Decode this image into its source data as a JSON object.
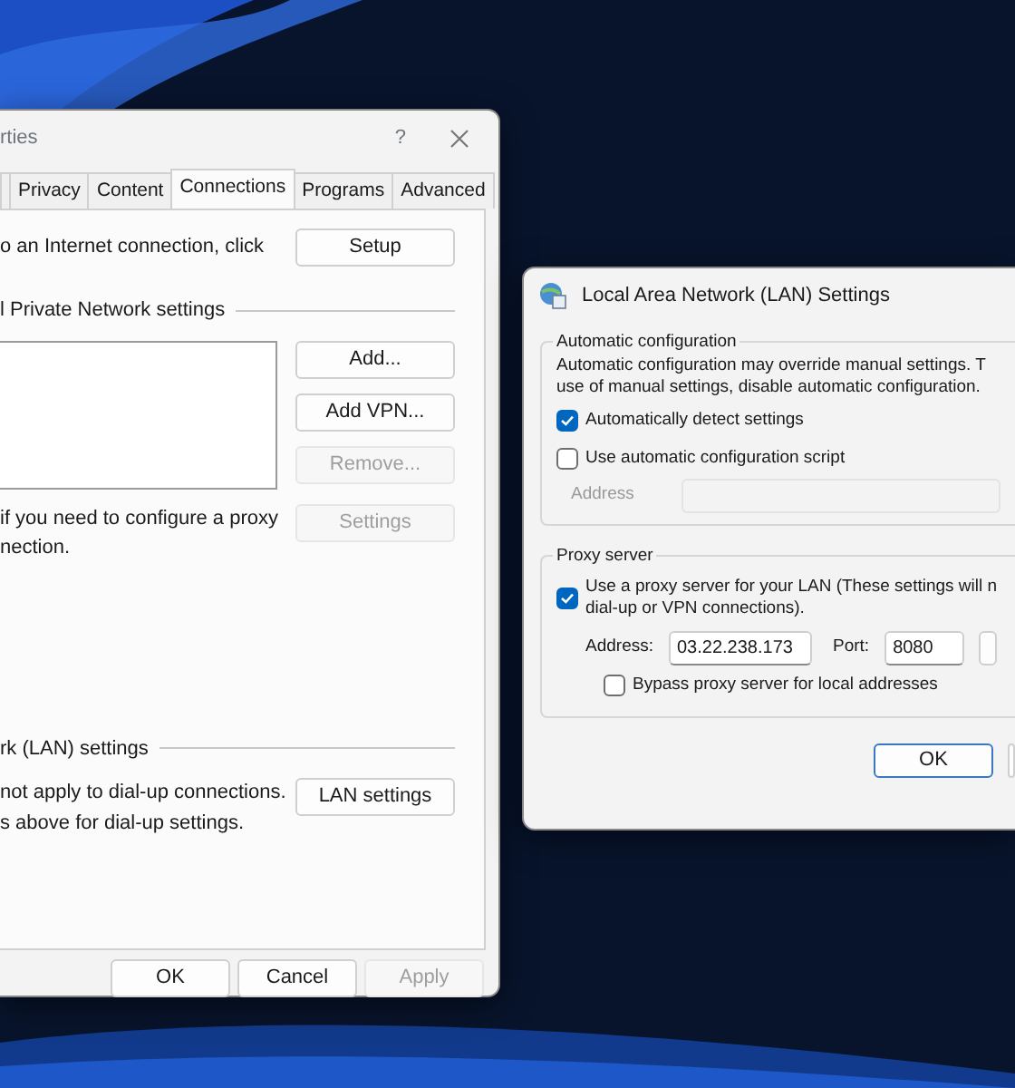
{
  "left_dialog": {
    "title": "rties",
    "help": "?",
    "tabs": [
      {
        "label": "Privacy",
        "selected": false
      },
      {
        "label": "Content",
        "selected": false
      },
      {
        "label": "Connections",
        "selected": true
      },
      {
        "label": "Programs",
        "selected": false
      },
      {
        "label": "Advanced",
        "selected": false
      }
    ],
    "setup_text": "o an Internet connection, click",
    "setup_button": {
      "label": "Setup",
      "disabled": false
    },
    "vpn_group": "l Private Network settings",
    "vpn_buttons": [
      {
        "label": "Add...",
        "disabled": false
      },
      {
        "label": "Add VPN...",
        "disabled": false
      },
      {
        "label": "Remove...",
        "disabled": true
      }
    ],
    "proxy_text": [
      "if you need to configure a proxy",
      "nection."
    ],
    "settings_button": {
      "label": "Settings",
      "disabled": true
    },
    "lan_group": "rk (LAN) settings",
    "lan_text": [
      "not apply to dial-up connections.",
      "s above for dial-up settings."
    ],
    "lan_button": {
      "label": "LAN settings",
      "disabled": false
    },
    "footer_buttons": [
      {
        "label": "OK",
        "disabled": false
      },
      {
        "label": "Cancel",
        "disabled": false
      },
      {
        "label": "Apply",
        "disabled": true
      }
    ]
  },
  "lan_dialog": {
    "title": "Local Area Network (LAN) Settings",
    "auto_group": "Automatic configuration",
    "auto_text": [
      "Automatic configuration may override manual settings.  T",
      "use of manual settings, disable automatic configuration."
    ],
    "auto_checks": [
      {
        "label": "Automatically detect settings",
        "checked": true
      },
      {
        "label": "Use automatic configuration script",
        "checked": false
      }
    ],
    "script_address": {
      "label": "Address",
      "disabled": true
    },
    "proxy_group": "Proxy server",
    "proxy_check": {
      "lines": [
        "Use a proxy server for your LAN (These settings will n",
        "dial-up or VPN connections)."
      ],
      "checked": true
    },
    "address_label": "Address:",
    "address_value": "03.22.238.173",
    "port_label": "Port:",
    "port_value": "8080",
    "bypass_check": {
      "label": "Bypass proxy server for local addresses",
      "checked": false
    },
    "ok_button": "OK"
  }
}
